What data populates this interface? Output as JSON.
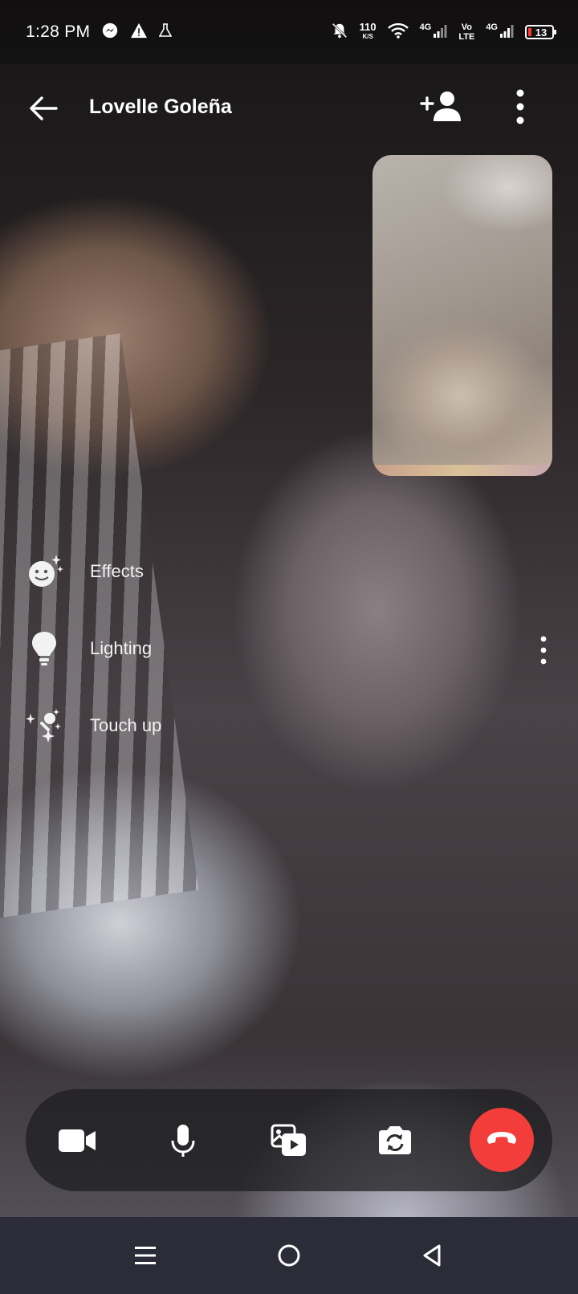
{
  "status_bar": {
    "time": "1:28 PM",
    "net_speed_value": "110",
    "net_speed_unit": "K/S",
    "net1": "4G",
    "volte_top": "Vo",
    "volte_bottom": "LTE",
    "net2": "4G",
    "battery": "13",
    "icons": [
      "messenger-icon",
      "warning-icon",
      "lab-flask-icon",
      "bell-off-icon",
      "wifi-icon",
      "signal-icon",
      "battery-icon"
    ]
  },
  "header": {
    "caller_name": "Lovelle Goleña",
    "icons": [
      "back-arrow-icon",
      "add-person-icon",
      "more-vertical-icon"
    ]
  },
  "effects": [
    {
      "label": "Effects",
      "icon": "smiley-sparkle-icon"
    },
    {
      "label": "Lighting",
      "icon": "lightbulb-icon"
    },
    {
      "label": "Touch up",
      "icon": "magic-wand-sparkle-icon"
    }
  ],
  "controls": {
    "icons": [
      "video-camera-icon",
      "microphone-icon",
      "share-media-icon",
      "flip-camera-icon",
      "end-call-icon"
    ],
    "end_call_color": "#f33d3a"
  },
  "nav": {
    "icons": [
      "recents-menu-icon",
      "home-circle-icon",
      "back-triangle-icon"
    ],
    "background": "#2b2c37"
  }
}
